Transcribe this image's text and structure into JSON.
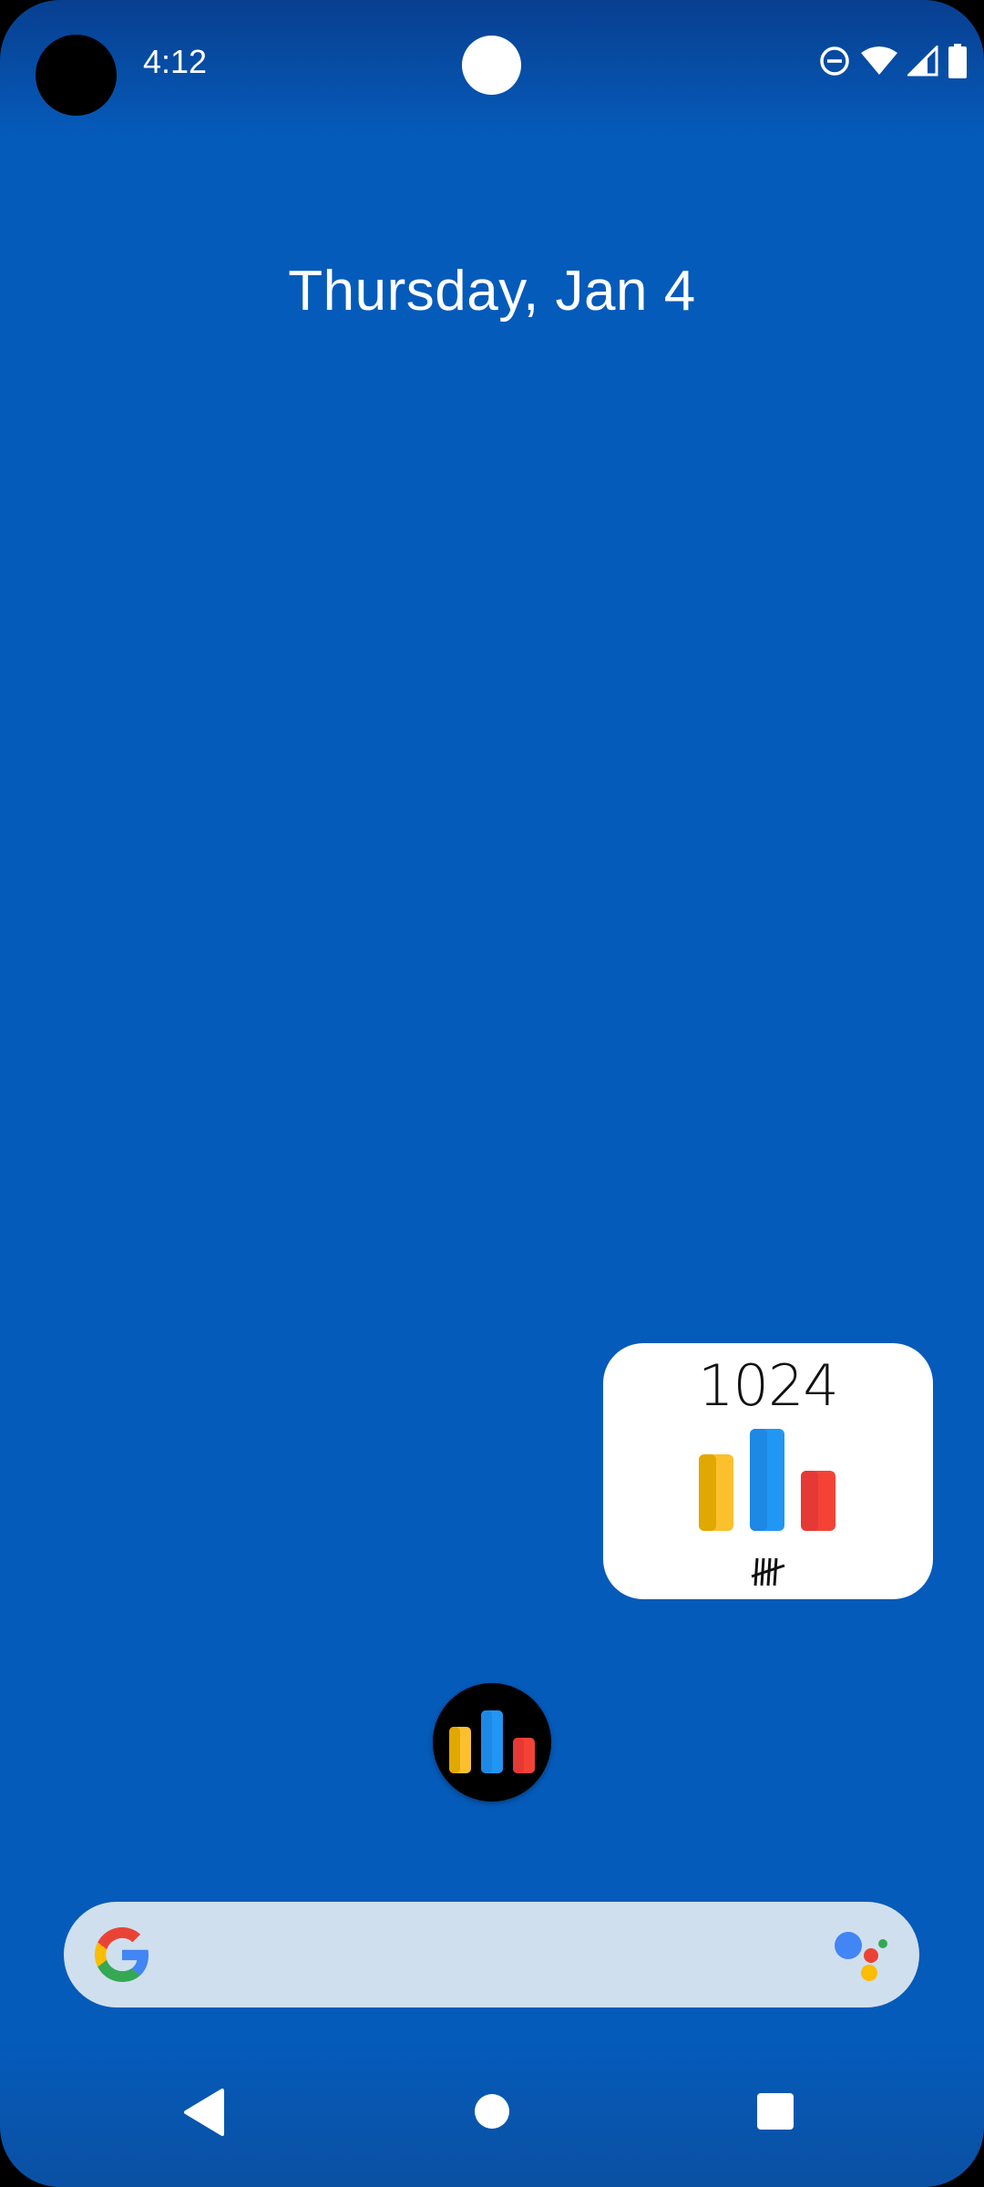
{
  "status_bar": {
    "time": "4:12",
    "icons": [
      "dnd-icon",
      "wifi-icon",
      "cell-signal-icon",
      "battery-icon"
    ]
  },
  "home": {
    "date": "Thursday, Jan 4"
  },
  "widget": {
    "count": "1024",
    "bar_icon": "bar-chart-icon",
    "tally_icon": "tally-marks-icon"
  },
  "app": {
    "icon": "bar-chart-app-icon"
  },
  "search_bar": {
    "left_icon": "google-g-icon",
    "right_icon": "assistant-icon"
  },
  "nav": {
    "back": "back-icon",
    "home": "home-icon",
    "recents": "recents-icon"
  },
  "colors": {
    "wallpaper": "#055bba",
    "bar_yellow": "#fbc02d",
    "bar_blue": "#2196f3",
    "bar_red": "#f44336",
    "search_bg": "#d0dfee"
  }
}
